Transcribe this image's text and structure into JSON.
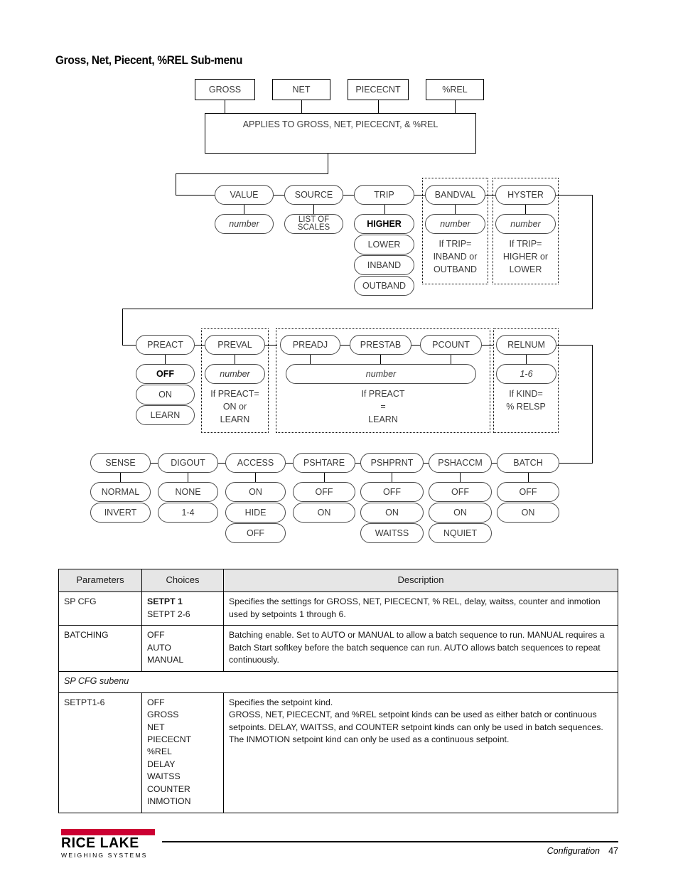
{
  "page": {
    "title": "Gross, Net, Piecent, %REL Sub-menu",
    "footer_section": "Configuration",
    "footer_page": "47",
    "logo_name": "RICE LAKE",
    "logo_sub": "WEIGHING SYSTEMS",
    "logo_color": "#cc0033"
  },
  "flow": {
    "top_row": [
      {
        "label": "GROSS"
      },
      {
        "label": "NET"
      },
      {
        "label": "PIECECNT"
      },
      {
        "label": "%REL"
      }
    ],
    "applies_box": "APPLIES TO GROSS, NET, PIECECNT, & %REL",
    "row2": [
      {
        "label": "VALUE",
        "child": "number",
        "child_italic": true
      },
      {
        "label": "SOURCE",
        "child": "LIST OF\nSCALES",
        "child_italic": false
      },
      {
        "label": "TRIP",
        "options": [
          "HIGHER",
          "LOWER",
          "INBAND",
          "OUTBAND"
        ],
        "default": "HIGHER"
      },
      {
        "label": "BANDVAL",
        "child": "number",
        "child_italic": true,
        "caption": "If TRIP=\nINBAND or\nOUTBAND"
      },
      {
        "label": "HYSTER",
        "child": "number",
        "child_italic": true,
        "caption": "If TRIP=\nHIGHER or\nLOWER"
      }
    ],
    "row3": [
      {
        "label": "PREACT",
        "options": [
          "OFF",
          "ON",
          "LEARN"
        ],
        "default": "OFF"
      },
      {
        "label": "PREVAL",
        "child": "number",
        "child_italic": true,
        "caption": "If PREACT=\nON or\nLEARN"
      },
      {
        "label": "PREADJ"
      },
      {
        "label": "PRESTAB"
      },
      {
        "label": "PCOUNT"
      },
      {
        "label": "RELNUM",
        "child": "1-6",
        "child_italic": true,
        "caption": "If KIND=\n% RELSP"
      }
    ],
    "row3_shared_child": "number",
    "row3_shared_caption": "If PREACT\n=\nLEARN",
    "row4": [
      {
        "label": "SENSE",
        "options": [
          "NORMAL",
          "INVERT"
        ]
      },
      {
        "label": "DIGOUT",
        "options": [
          "NONE",
          "1-4"
        ]
      },
      {
        "label": "ACCESS",
        "options": [
          "ON",
          "HIDE",
          "OFF"
        ]
      },
      {
        "label": "PSHTARE",
        "options": [
          "OFF",
          "ON"
        ]
      },
      {
        "label": "PSHPRNT",
        "options": [
          "OFF",
          "ON",
          "WAITSS"
        ]
      },
      {
        "label": "PSHACCM",
        "options": [
          "OFF",
          "ON",
          "NQUIET"
        ]
      },
      {
        "label": "BATCH",
        "options": [
          "OFF",
          "ON"
        ]
      }
    ]
  },
  "table": {
    "headers": [
      "Parameters",
      "Choices",
      "Description"
    ],
    "rows": [
      {
        "parameter": "SP CFG",
        "choices": [
          "SETPT 1",
          "SETPT 2-6"
        ],
        "choices_first_bold": true,
        "description": "Specifies the settings for GROSS, NET, PIECECNT, % REL, delay, waitss, counter and inmotion used by setpoints 1 through 6."
      },
      {
        "parameter": "BATCHING",
        "choices": [
          "OFF",
          "AUTO",
          "MANUAL"
        ],
        "choices_first_bold": false,
        "description": "Batching enable. Set to AUTO or MANUAL to allow a batch sequence to run. MANUAL requires a Batch Start softkey before the batch sequence can run. AUTO allows batch sequences to repeat continuously."
      }
    ],
    "subheader": "SP CFG subenu",
    "sub_rows": [
      {
        "parameter": "SETPT1-6",
        "choices": [
          "OFF",
          "GROSS",
          "NET",
          "PIECECNT",
          "%REL",
          "DELAY",
          "WAITSS",
          "COUNTER",
          "INMOTION"
        ],
        "choices_first_bold": false,
        "description_lines": [
          "Specifies the setpoint kind.",
          "GROSS, NET, PIECECNT, and %REL setpoint kinds can be used as either batch or continuous setpoints. DELAY, WAITSS, and COUNTER setpoint kinds can only be used in batch sequences.",
          "The INMOTION setpoint kind can only be used as a continuous setpoint."
        ]
      }
    ]
  }
}
